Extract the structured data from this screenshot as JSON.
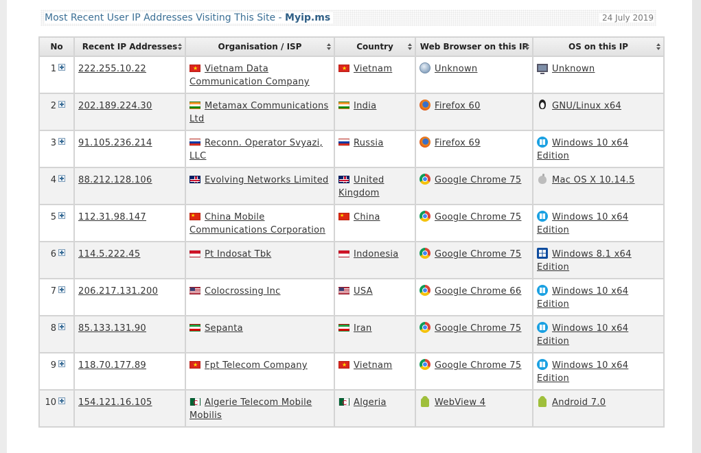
{
  "header": {
    "title_text": "Most Recent User IP Addresses Visiting This Site - ",
    "brand": "Myip.ms",
    "date": "24 July 2019"
  },
  "table": {
    "columns": [
      "No",
      "Recent IP Addresses",
      "Organisation / ISP",
      "Country",
      "Web Browser on this IP",
      "OS on this IP"
    ],
    "rows": [
      {
        "no": "1",
        "ip": "222.255.10.22",
        "org": "Vietnam Data Communication Company",
        "org_flag": "flag-vn",
        "country": "Vietnam",
        "country_flag": "flag-vn",
        "browser": "Unknown",
        "browser_icon": "unknown-browser-icon",
        "os": "Unknown",
        "os_icon": "monitor-icon"
      },
      {
        "no": "2",
        "ip": "202.189.224.30",
        "org": "Metamax Communications Ltd",
        "org_flag": "flag-in",
        "country": "India",
        "country_flag": "flag-in",
        "browser": "Firefox 60",
        "browser_icon": "firefox-icon",
        "os": "GNU/Linux x64",
        "os_icon": "linux-icon"
      },
      {
        "no": "3",
        "ip": "91.105.236.214",
        "org": "Reconn. Operator Svyazi, LLC",
        "org_flag": "flag-ru",
        "country": "Russia",
        "country_flag": "flag-ru",
        "browser": "Firefox 69",
        "browser_icon": "firefox-icon",
        "os": "Windows 10 x64 Edition",
        "os_icon": "windows-10-icon"
      },
      {
        "no": "4",
        "ip": "88.212.128.106",
        "org": "Evolving Networks Limited",
        "org_flag": "flag-gb",
        "country": "United Kingdom",
        "country_flag": "flag-gb",
        "browser": "Google Chrome 75",
        "browser_icon": "chrome-icon",
        "os": "Mac OS X 10.14.5",
        "os_icon": "apple-icon"
      },
      {
        "no": "5",
        "ip": "112.31.98.147",
        "org": "China Mobile Communications Corporation",
        "org_flag": "flag-cn",
        "country": "China",
        "country_flag": "flag-cn",
        "browser": "Google Chrome 75",
        "browser_icon": "chrome-icon",
        "os": "Windows 10 x64 Edition",
        "os_icon": "windows-10-icon"
      },
      {
        "no": "6",
        "ip": "114.5.222.45",
        "org": "Pt Indosat Tbk",
        "org_flag": "flag-id",
        "country": "Indonesia",
        "country_flag": "flag-id",
        "browser": "Google Chrome 75",
        "browser_icon": "chrome-icon",
        "os": "Windows 8.1 x64 Edition",
        "os_icon": "windows-8-icon"
      },
      {
        "no": "7",
        "ip": "206.217.131.200",
        "org": "Colocrossing Inc",
        "org_flag": "flag-us",
        "country": "USA",
        "country_flag": "flag-us",
        "browser": "Google Chrome 66",
        "browser_icon": "chrome-icon",
        "os": "Windows 10 x64 Edition",
        "os_icon": "windows-10-icon"
      },
      {
        "no": "8",
        "ip": "85.133.131.90",
        "org": "Sepanta",
        "org_flag": "flag-ir",
        "country": "Iran",
        "country_flag": "flag-ir",
        "browser": "Google Chrome 75",
        "browser_icon": "chrome-icon",
        "os": "Windows 10 x64 Edition",
        "os_icon": "windows-10-icon"
      },
      {
        "no": "9",
        "ip": "118.70.177.89",
        "org": "Fpt Telecom Company",
        "org_flag": "flag-vn",
        "country": "Vietnam",
        "country_flag": "flag-vn",
        "browser": "Google Chrome 75",
        "browser_icon": "chrome-icon",
        "os": "Windows 10 x64 Edition",
        "os_icon": "windows-10-icon"
      },
      {
        "no": "10",
        "ip": "154.121.16.105",
        "org": "Algerie Telecom Mobile Mobilis",
        "org_flag": "flag-dz",
        "country": "Algeria",
        "country_flag": "flag-dz",
        "browser": "WebView 4",
        "browser_icon": "android-icon",
        "os": "Android 7.0",
        "os_icon": "android-icon"
      }
    ]
  },
  "colors": {
    "title": "#3b6f95",
    "header_bg": "#e9e9e9",
    "border": "#d4d4d4",
    "alt_row": "#f2f2f2"
  }
}
